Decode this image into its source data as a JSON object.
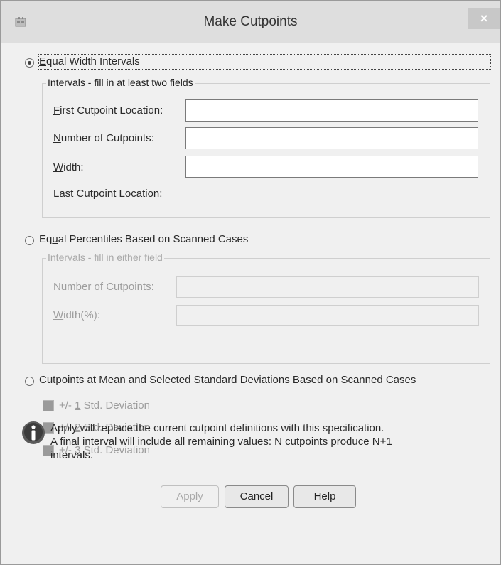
{
  "window": {
    "title": "Make Cutpoints",
    "close_glyph": "×",
    "app_icon": "dialog-app-icon"
  },
  "equal_width": {
    "label": "Equal Width Intervals",
    "label_mnemonic": "E",
    "label_rest": "qual Width Intervals",
    "selected": true,
    "group_title": "Intervals - fill in at least two fields",
    "first_cutpoint_mn": "F",
    "first_cutpoint_rest": "irst Cutpoint Location:",
    "first_cutpoint_value": "",
    "num_cutpoints_mn": "N",
    "num_cutpoints_rest": "umber of Cutpoints:",
    "num_cutpoints_value": "",
    "width_mn": "W",
    "width_rest": "idth:",
    "width_value": "",
    "last_cutpoint_label": "Last Cutpoint Location:"
  },
  "equal_percentiles": {
    "label_pre": "Eq",
    "label_mnemonic": "u",
    "label_rest": "al Percentiles Based on Scanned Cases",
    "selected": false,
    "group_title": "Intervals - fill in either field",
    "num_cutpoints_mn": "N",
    "num_cutpoints_rest": "umber of Cutpoints:",
    "width_mn": "W",
    "width_rest": "idth(%):"
  },
  "std_dev": {
    "label_mnemonic": "C",
    "label_rest": "utpoints at Mean and Selected Standard Deviations Based on Scanned Cases",
    "selected": false,
    "options": [
      {
        "pre": "+/- ",
        "mn": "1",
        "rest": " Std. Deviation"
      },
      {
        "pre": "+/- ",
        "mn": "2",
        "rest": " Std. Deviation"
      },
      {
        "pre": "+/- ",
        "mn": "3",
        "rest": " Std. Deviation"
      }
    ]
  },
  "info": {
    "line1": "Apply will replace the current cutpoint definitions with this specification.",
    "line2": "A final interval will include all remaining values: N cutpoints produce N+1",
    "line3": "intervals."
  },
  "buttons": {
    "apply": "Apply",
    "cancel": "Cancel",
    "help": "Help"
  }
}
